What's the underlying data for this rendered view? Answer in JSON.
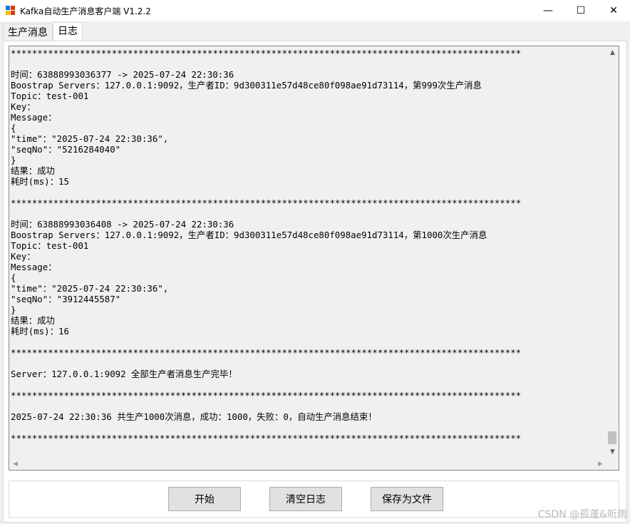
{
  "window": {
    "title": "Kafka自动生产消息客户端 V1.2.2",
    "controls": {
      "minimize": "—",
      "maximize": "☐",
      "close": "✕"
    }
  },
  "tabs": [
    {
      "label": "生产消息",
      "active": false
    },
    {
      "label": "日志",
      "active": true
    }
  ],
  "log_lines": [
    "************************************************************************************************",
    "",
    "时间：63888993036377 -> 2025-07-24 22:30:36",
    "Boostrap Servers：127.0.0.1:9092，生产者ID：9d300311e57d48ce80f098ae91d73114，第999次生产消息",
    "Topic：test-001",
    "Key：",
    "Message：",
    "{",
    "\"time\"：\"2025-07-24 22:30:36\",",
    "\"seqNo\"：\"5216284040\"",
    "}",
    "结果：成功",
    "耗时(ms)：15",
    "",
    "************************************************************************************************",
    "",
    "时间：63888993036408 -> 2025-07-24 22:30:36",
    "Boostrap Servers：127.0.0.1:9092，生产者ID：9d300311e57d48ce80f098ae91d73114，第1000次生产消息",
    "Topic：test-001",
    "Key：",
    "Message：",
    "{",
    "\"time\"：\"2025-07-24 22:30:36\",",
    "\"seqNo\"：\"3912445587\"",
    "}",
    "结果：成功",
    "耗时(ms)：16",
    "",
    "************************************************************************************************",
    "",
    "Server：127.0.0.1:9092 全部生产者消息生产完毕！",
    "",
    "************************************************************************************************",
    "",
    "2025-07-24 22:30:36 共生产1000次消息，成功：1000，失败：0，自动生产消息结束！",
    "",
    "************************************************************************************************"
  ],
  "buttons": {
    "start": "开始",
    "clear_log": "清空日志",
    "save_to_file": "保存为文件"
  },
  "watermark": "CSDN @孤蓬&听雨",
  "colors": {
    "app_icon_red": "#d83b01",
    "app_icon_blue": "#0078d7",
    "app_icon_yellow": "#ffb900"
  }
}
